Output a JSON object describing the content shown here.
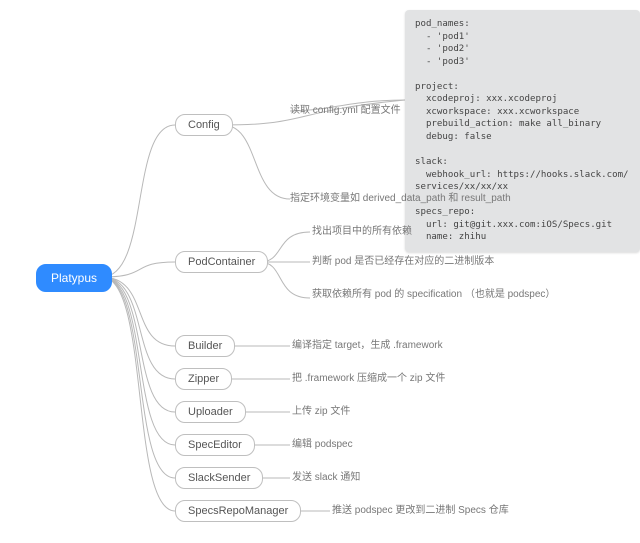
{
  "root": {
    "label": "Platypus"
  },
  "children": {
    "config": {
      "label": "Config"
    },
    "podcontainer": {
      "label": "PodContainer"
    },
    "builder": {
      "label": "Builder"
    },
    "zipper": {
      "label": "Zipper"
    },
    "uploader": {
      "label": "Uploader"
    },
    "speceditor": {
      "label": "SpecEditor"
    },
    "slacksender": {
      "label": "SlackSender"
    },
    "specsrepomanager": {
      "label": "SpecsRepoManager"
    }
  },
  "leaves": {
    "config_read": "读取 config.yml 配置文件",
    "config_env": "指定环境变量如 derived_data_path 和 result_path",
    "pc_find": "找出项目中的所有依赖",
    "pc_judge": "判断 pod 是否已经存在对应的二进制版本",
    "pc_spec": "获取依赖所有 pod 的 specification （也就是\npodspec）",
    "builder_do": "编译指定 target，生成 .framework",
    "zipper_do": "把 .framework 压缩成一个 zip 文件",
    "uploader_do": "上传 zip 文件",
    "speceditor_do": "编辑 podspec",
    "slack_do": "发送 slack 通知",
    "srm_do": "推送 podspec 更改到二进制 Specs 仓库"
  },
  "code": "pod_names:\n  - 'pod1'\n  - 'pod2'\n  - 'pod3'\n\nproject:\n  xcodeproj: xxx.xcodeproj\n  xcworkspace: xxx.xcworkspace\n  prebuild_action: make all_binary\n  debug: false\n\nslack:\n  webhook_url: https://hooks.slack.com/\nservices/xx/xx/xx\n\nspecs_repo:\n  url: git@git.xxx.com:iOS/Specs.git\n  name: zhihu"
}
